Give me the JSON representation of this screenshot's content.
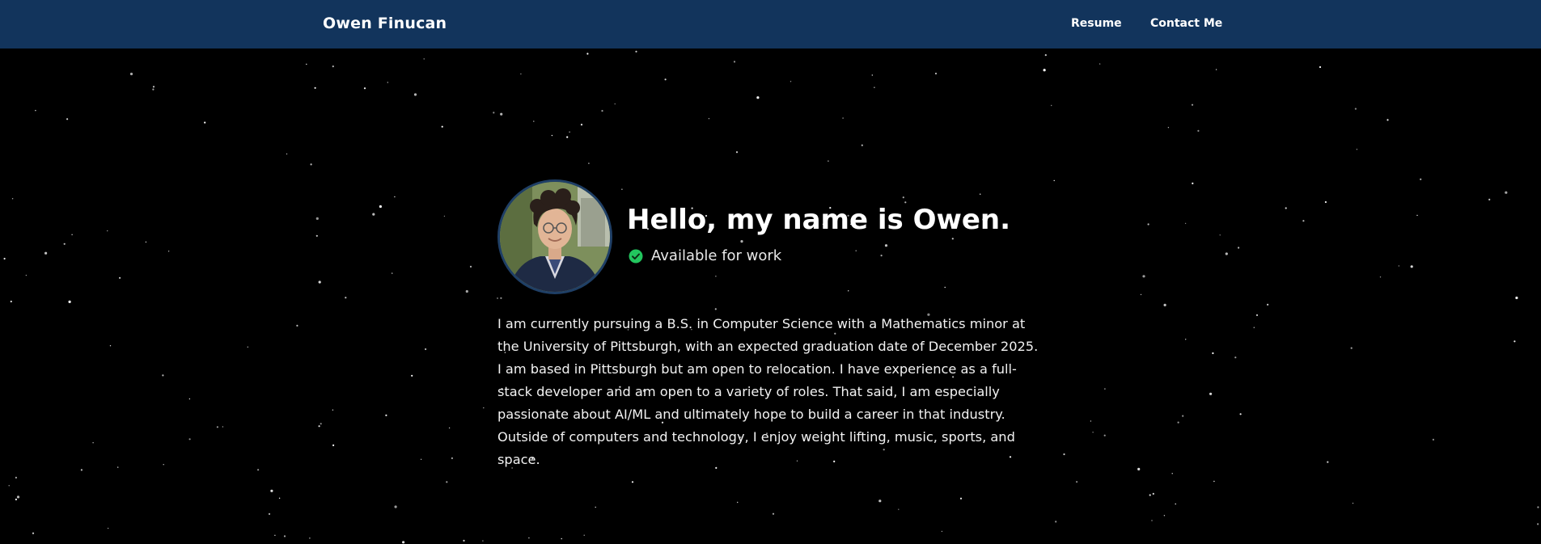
{
  "navbar": {
    "brand": "Owen Finucan",
    "links": [
      {
        "label": "Resume"
      },
      {
        "label": "Contact Me"
      }
    ]
  },
  "hero": {
    "greeting": "Hello, my name is Owen.",
    "status": "Available for work",
    "bio": "I am currently pursuing a B.S. in Computer Science with a Mathematics minor at the University of Pittsburgh, with an expected graduation date of December 2025. I am based in Pittsburgh but am open to relocation. I have experience as a full-stack developer and am open to a variety of roles. That said, I am especially passionate about AI/ML and ultimately hope to build a career in that industry. Outside of computers and technology, I enjoy weight lifting, music, sports, and space."
  },
  "colors": {
    "navbar_bg": "#12345c",
    "page_bg": "#000000",
    "status_green": "#22c55e",
    "avatar_border": "#1f3f66"
  },
  "icons": {
    "status": "check-circle-icon"
  }
}
